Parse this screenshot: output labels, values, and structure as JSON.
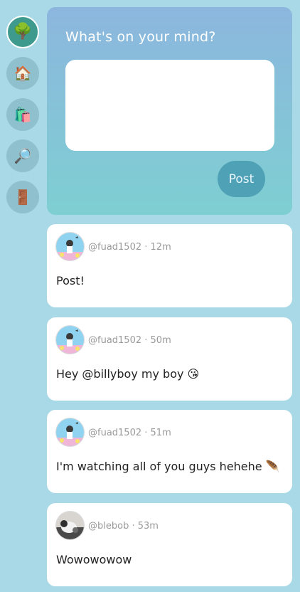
{
  "nav": {
    "items": [
      {
        "icon": "🌳",
        "name": "tree-icon",
        "active": true
      },
      {
        "icon": "🏠",
        "name": "home-icon"
      },
      {
        "icon": "🛍️",
        "name": "shopping-bags-icon"
      },
      {
        "icon": "🔎",
        "name": "search-icon"
      },
      {
        "icon": "🚪",
        "name": "door-icon"
      }
    ]
  },
  "composer": {
    "title": "What's on your mind?",
    "post_label": "Post"
  },
  "posts": [
    {
      "handle": "@fuad1502",
      "sep": " · ",
      "time": "12m",
      "text": "Post!"
    },
    {
      "handle": "@fuad1502",
      "sep": " · ",
      "time": "50m",
      "text": "Hey @billyboy my boy 😘"
    },
    {
      "handle": "@fuad1502",
      "sep": " · ",
      "time": "51m",
      "text": "I'm watching all of you guys hehehe 🪶"
    },
    {
      "handle": "@blebob",
      "sep": " · ",
      "time": "53m",
      "text": "Wowowowow"
    }
  ],
  "colors": {
    "background": "#a9d9e6",
    "accent": "#4fa1b6",
    "composer_top": "#8cb6de",
    "composer_bottom": "#7ecfd2"
  }
}
